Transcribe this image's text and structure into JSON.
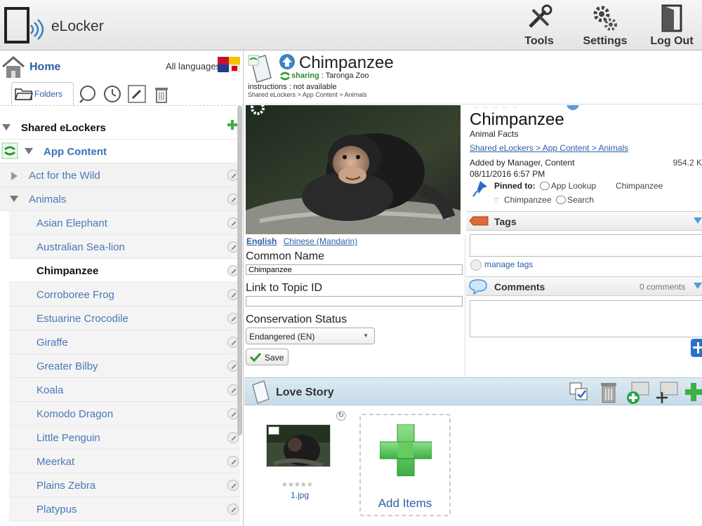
{
  "app": {
    "title": "eLocker"
  },
  "topnav": {
    "tools": "Tools",
    "settings": "Settings",
    "logout": "Log Out"
  },
  "sidebar": {
    "home": "Home",
    "languages": "All languages",
    "folders_tab": "Folders",
    "tree": [
      {
        "label": "Shared eLockers",
        "level": 0,
        "expanded": true
      },
      {
        "label": "App Content",
        "level": 1,
        "expanded": true
      },
      {
        "label": "Act for the Wild",
        "level": 2,
        "expanded": false
      },
      {
        "label": "Animals",
        "level": 2,
        "expanded": true
      },
      {
        "label": "Asian Elephant",
        "level": 3
      },
      {
        "label": "Australian Sea-lion",
        "level": 3
      },
      {
        "label": "Chimpanzee",
        "level": 3,
        "selected": true
      },
      {
        "label": "Corroboree Frog",
        "level": 3
      },
      {
        "label": "Estuarine Crocodile",
        "level": 3
      },
      {
        "label": "Giraffe",
        "level": 3
      },
      {
        "label": "Greater Bilby",
        "level": 3
      },
      {
        "label": "Koala",
        "level": 3
      },
      {
        "label": "Komodo Dragon",
        "level": 3
      },
      {
        "label": "Little Penguin",
        "level": 3
      },
      {
        "label": "Meerkat",
        "level": 3
      },
      {
        "label": "Plains Zebra",
        "level": 3
      },
      {
        "label": "Platypus",
        "level": 3
      }
    ]
  },
  "header": {
    "title": "Chimpanzee",
    "sharing_label": "sharing",
    "sharing_value": " : Taronga Zoo",
    "instructions": "instructions : not available",
    "breadcrumb": "Shared eLockers > App Content > Animals"
  },
  "editor": {
    "languages": [
      "English",
      "Chinese (Mandarin)"
    ],
    "common_name_label": "Common Name",
    "common_name_value": "Chimpanzee",
    "link_label": "Link to Topic ID",
    "link_value": "",
    "status_label": "Conservation Status",
    "status_value": "Endangered (EN)",
    "save": "Save"
  },
  "details": {
    "title": "Chimpanzee",
    "subtitle": "Animal Facts",
    "path": "Shared eLockers > App Content > Animals",
    "added_by": "Added by Manager, Content",
    "size": "954.2 K",
    "date": "08/11/2016 6:57 PM",
    "pinned_label": "Pinned to:",
    "pins": [
      "App Lookup",
      "Chimpanzee",
      "Chimpanzee",
      "Search"
    ],
    "tags_title": "Tags",
    "manage_tags": "manage tags",
    "comments_title": "Comments",
    "comments_count": "0 comments"
  },
  "story": {
    "title": "Love Story",
    "file_name": "1.jpg",
    "add_items": "Add Items"
  }
}
